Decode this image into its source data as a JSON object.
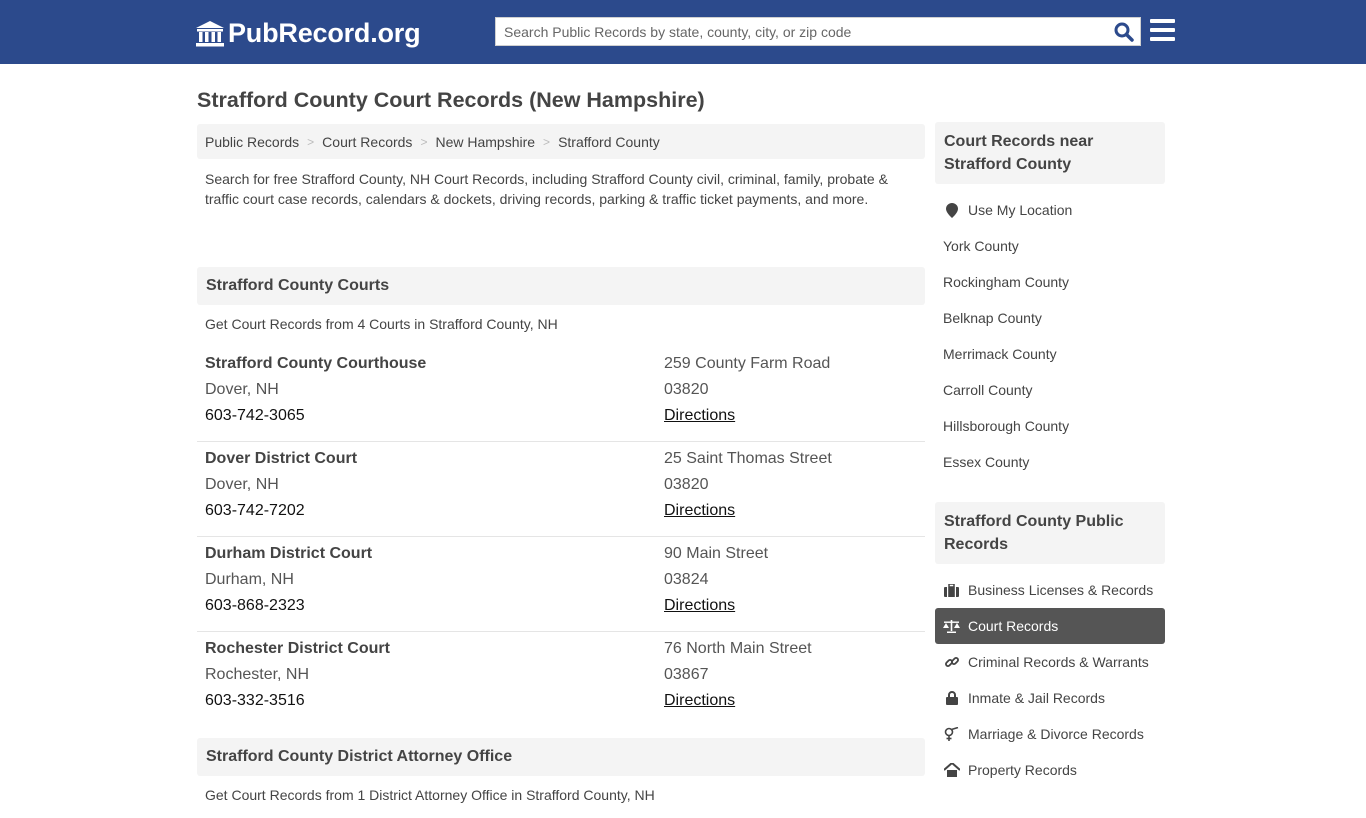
{
  "header": {
    "logo_text": "PubRecord.org",
    "search_placeholder": "Search Public Records by state, county, city, or zip code",
    "brand_color": "#2c4a8c"
  },
  "page_title": "Strafford County Court Records (New Hampshire)",
  "breadcrumb": [
    "Public Records",
    "Court Records",
    "New Hampshire",
    "Strafford County"
  ],
  "intro": "Search for free Strafford County, NH Court Records, including Strafford County civil, criminal, family, probate & traffic court case records, calendars & dockets, driving records, parking & traffic ticket payments, and more.",
  "courts_section": {
    "heading": "Strafford County Courts",
    "subtitle": "Get Court Records from 4 Courts in Strafford County, NH",
    "items": [
      {
        "name": "Strafford County Courthouse",
        "city": "Dover, NH",
        "phone": "603-742-3065",
        "address": "259 County Farm Road",
        "zip": "03820",
        "link": "Directions"
      },
      {
        "name": "Dover District Court",
        "city": "Dover, NH",
        "phone": "603-742-7202",
        "address": "25 Saint Thomas Street",
        "zip": "03820",
        "link": "Directions"
      },
      {
        "name": "Durham District Court",
        "city": "Durham, NH",
        "phone": "603-868-2323",
        "address": "90 Main Street",
        "zip": "03824",
        "link": "Directions"
      },
      {
        "name": "Rochester District Court",
        "city": "Rochester, NH",
        "phone": "603-332-3516",
        "address": "76 North Main Street",
        "zip": "03867",
        "link": "Directions"
      }
    ]
  },
  "da_section": {
    "heading": "Strafford County District Attorney Office",
    "subtitle": "Get Court Records from 1 District Attorney Office in Strafford County, NH"
  },
  "sidebar": {
    "nearby": {
      "heading": "Court Records near Strafford County",
      "location_label": "Use My Location",
      "counties": [
        "York County",
        "Rockingham County",
        "Belknap County",
        "Merrimack County",
        "Carroll County",
        "Hillsborough County",
        "Essex County"
      ]
    },
    "public_records": {
      "heading": "Strafford County Public Records",
      "items": [
        {
          "label": "Business Licenses & Records",
          "icon": "briefcase-icon",
          "active": false
        },
        {
          "label": "Court Records",
          "icon": "scales-icon",
          "active": true
        },
        {
          "label": "Criminal Records & Warrants",
          "icon": "link-icon",
          "active": false
        },
        {
          "label": "Inmate & Jail Records",
          "icon": "lock-icon",
          "active": false
        },
        {
          "label": "Marriage & Divorce Records",
          "icon": "gender-icon",
          "active": false
        },
        {
          "label": "Property Records",
          "icon": "home-icon",
          "active": false
        }
      ]
    }
  }
}
